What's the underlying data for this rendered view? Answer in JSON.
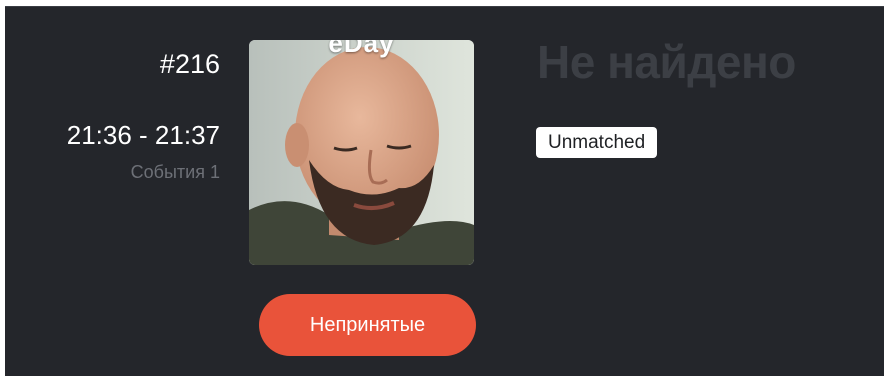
{
  "event": {
    "number": "#216",
    "time_range": "21:36 - 21:37",
    "events_count": "События 1"
  },
  "photo": {
    "caption": "eDay",
    "alt": "face-photo"
  },
  "match": {
    "title": "Не найдено",
    "badge": "Unmatched"
  },
  "actions": {
    "status_button": "Непринятые"
  },
  "colors": {
    "background": "#24262b",
    "accent": "#e9533a",
    "muted_text": "#6d7077",
    "title_text": "#3c3f45"
  }
}
